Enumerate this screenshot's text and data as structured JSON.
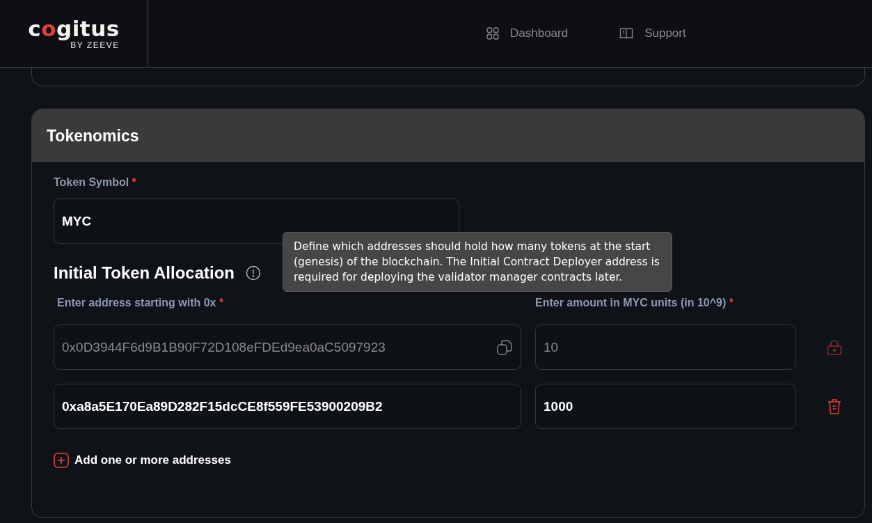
{
  "header": {
    "logo": {
      "name": "cogitus",
      "tagline": "BY ZEEVE"
    },
    "nav": [
      {
        "label": "Dashboard",
        "kind": "grid"
      },
      {
        "label": "Support",
        "kind": "book"
      }
    ]
  },
  "tokenomics": {
    "title": "Tokenomics",
    "token_symbol": {
      "label": "Token Symbol",
      "required_mark": "*",
      "value": "MYC"
    },
    "allocation": {
      "title": "Initial Token Allocation",
      "tooltip": "Define which addresses should hold how many tokens at the start (genesis) of the blockchain. The Initial Contract Deployer address is required for deploying the validator manager contracts later.",
      "address_label": {
        "text": "Enter address starting with 0x",
        "required_mark": "*"
      },
      "amount_label": {
        "text": "Enter amount in MYC units (in 10^9)",
        "required_mark": "*"
      },
      "rows": [
        {
          "address": "0x0D3944F6d9B1B90F72D108eFDEd9ea0aC5097923",
          "amount": "10",
          "locked": true
        },
        {
          "address": "0xa8a5E170Ea89D282F15dcCE8f559FE53900209B2",
          "amount": "1000",
          "locked": false
        }
      ],
      "add_button": "Add one or more addresses"
    }
  }
}
